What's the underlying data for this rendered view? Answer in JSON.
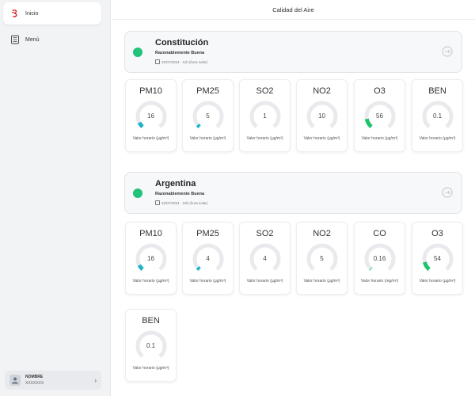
{
  "sidebar": {
    "items": [
      {
        "label": "Inicio",
        "icon": "logo-icon",
        "active": true
      },
      {
        "label": "Menú",
        "icon": "menu-list-icon",
        "active": false
      }
    ],
    "user": {
      "name": "NOMBRE",
      "sub": "XXXXXXX"
    }
  },
  "header": {
    "title": "Calidad del Aire"
  },
  "colors": {
    "good": "#21c37a",
    "teal": "#1cb5c8",
    "green": "#1fc36b",
    "track": "#e9eaed"
  },
  "stations": [
    {
      "name": "Constitución",
      "quality": "Razonablemente Buena",
      "updated": "22/07/2024 - 11h (hora solar)",
      "metrics": [
        {
          "name": "PM10",
          "value": "16",
          "unit": "Valor horario (µg/m³)",
          "level": 0.08,
          "color": "#1cb5c8"
        },
        {
          "name": "PM25",
          "value": "5",
          "unit": "Valor horario (µg/m³)",
          "level": 0.04,
          "color": "#1cb5c8"
        },
        {
          "name": "SO2",
          "value": "1",
          "unit": "Valor horario (µg/m³)",
          "level": 0.0,
          "color": "#1cb5c8"
        },
        {
          "name": "NO2",
          "value": "10",
          "unit": "Valor horario (µg/m³)",
          "level": 0.0,
          "color": "#1cb5c8"
        },
        {
          "name": "O3",
          "value": "56",
          "unit": "Valor horario (µg/m³)",
          "level": 0.14,
          "color": "#1fc36b"
        },
        {
          "name": "BEN",
          "value": "0.1",
          "unit": "Valor horario (µg/m³)",
          "level": 0.0,
          "color": "#1cb5c8"
        }
      ]
    },
    {
      "name": "Argentina",
      "quality": "Razonablemente Buena",
      "updated": "22/07/2024 - 10h (hora solar)",
      "metrics": [
        {
          "name": "PM10",
          "value": "16",
          "unit": "Valor horario (µg/m³)",
          "level": 0.08,
          "color": "#1cb5c8"
        },
        {
          "name": "PM25",
          "value": "4",
          "unit": "Valor horario (µg/m³)",
          "level": 0.04,
          "color": "#1cb5c8"
        },
        {
          "name": "SO2",
          "value": "4",
          "unit": "Valor horario (µg/m³)",
          "level": 0.0,
          "color": "#1cb5c8"
        },
        {
          "name": "NO2",
          "value": "5",
          "unit": "Valor horario (µg/m³)",
          "level": 0.0,
          "color": "#1cb5c8"
        },
        {
          "name": "CO",
          "value": "0.16",
          "unit": "Valor horario (mg/m³)",
          "level": 0.02,
          "color": "#7fd6c0"
        },
        {
          "name": "O3",
          "value": "54",
          "unit": "Valor horario (µg/m³)",
          "level": 0.13,
          "color": "#1fc36b"
        },
        {
          "name": "BEN",
          "value": "0.1",
          "unit": "Valor horario (µg/m³)",
          "level": 0.0,
          "color": "#1cb5c8"
        }
      ]
    }
  ]
}
